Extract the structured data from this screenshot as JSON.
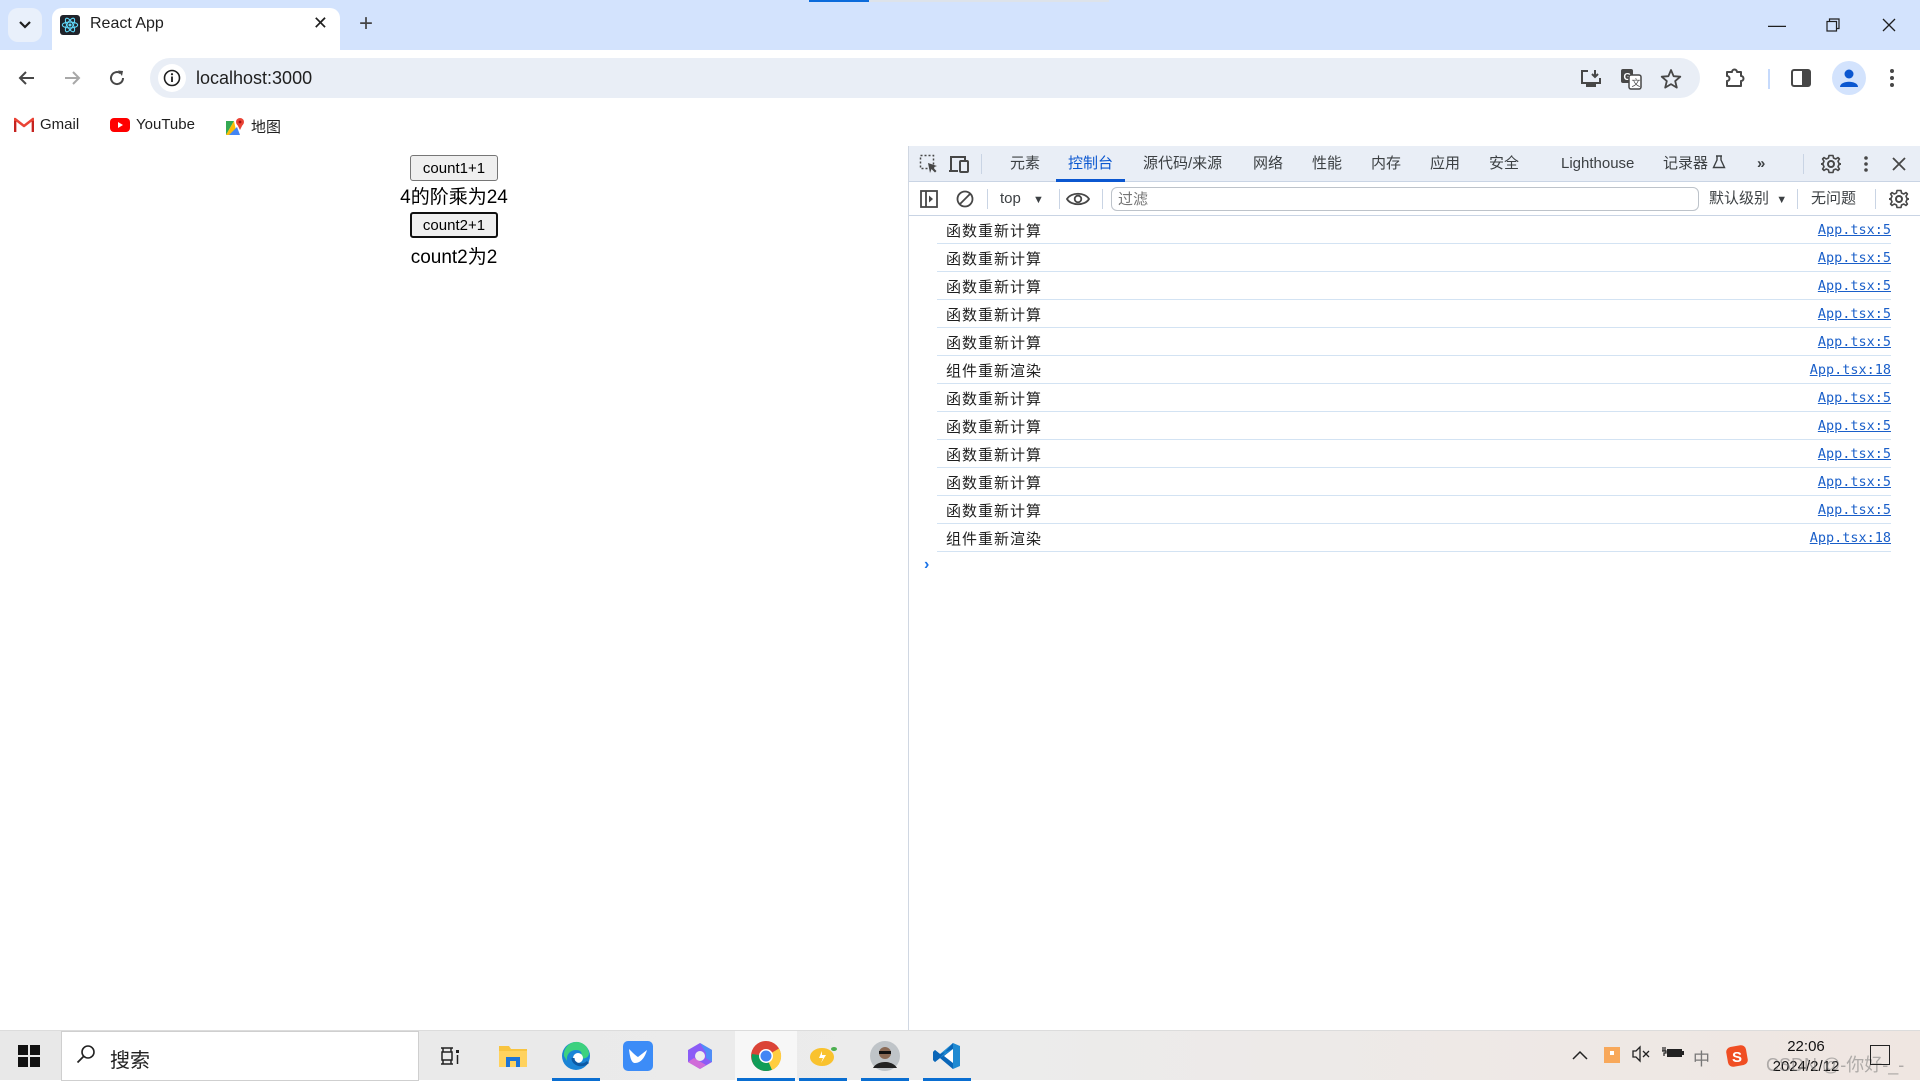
{
  "browser": {
    "tab": {
      "title": "React App",
      "favicon": "react-icon"
    },
    "new_tab_label": "+",
    "url": "localhost:3000",
    "window_controls": {
      "minimize": "—",
      "restore": "❐",
      "close": "✕"
    },
    "bookmarks": [
      {
        "label": "Gmail",
        "icon": "gmail-icon"
      },
      {
        "label": "YouTube",
        "icon": "youtube-icon"
      },
      {
        "label": "地图",
        "icon": "maps-icon"
      }
    ]
  },
  "page": {
    "count1_button": "count1+1",
    "factorial_text": "4的阶乘为24",
    "count2_button": "count2+1",
    "count2_text": "count2为2"
  },
  "devtools": {
    "tabs": [
      {
        "label": "元素",
        "active": false
      },
      {
        "label": "控制台",
        "active": true
      },
      {
        "label": "源代码/来源",
        "active": false
      },
      {
        "label": "网络",
        "active": false
      },
      {
        "label": "性能",
        "active": false
      },
      {
        "label": "内存",
        "active": false
      },
      {
        "label": "应用",
        "active": false
      },
      {
        "label": "安全",
        "active": false
      },
      {
        "label": "Lighthouse",
        "active": false
      },
      {
        "label": "记录器",
        "active": false
      }
    ],
    "more_tabs": "»",
    "console_toolbar": {
      "context": "top",
      "filter_placeholder": "过滤",
      "level": "默认级别",
      "issues": "无问题"
    },
    "logs": [
      {
        "message": "函数重新计算",
        "source": "App.tsx:5"
      },
      {
        "message": "函数重新计算",
        "source": "App.tsx:5"
      },
      {
        "message": "函数重新计算",
        "source": "App.tsx:5"
      },
      {
        "message": "函数重新计算",
        "source": "App.tsx:5"
      },
      {
        "message": "函数重新计算",
        "source": "App.tsx:5"
      },
      {
        "message": "组件重新渲染",
        "source": "App.tsx:18"
      },
      {
        "message": "函数重新计算",
        "source": "App.tsx:5"
      },
      {
        "message": "函数重新计算",
        "source": "App.tsx:5"
      },
      {
        "message": "函数重新计算",
        "source": "App.tsx:5"
      },
      {
        "message": "函数重新计算",
        "source": "App.tsx:5"
      },
      {
        "message": "函数重新计算",
        "source": "App.tsx:5"
      },
      {
        "message": "组件重新渲染",
        "source": "App.tsx:18"
      }
    ],
    "prompt": "›"
  },
  "taskbar": {
    "search_label": "搜索",
    "apps": [
      "task-view",
      "file-explorer",
      "edge",
      "feishu",
      "microsoft-365",
      "chrome",
      "lemon-app",
      "avatar-app",
      "vscode"
    ],
    "tray": {
      "ime": "中",
      "time": "22:06",
      "date": "2024/2/12"
    },
    "watermark": "CSDN @-你好-_-"
  }
}
